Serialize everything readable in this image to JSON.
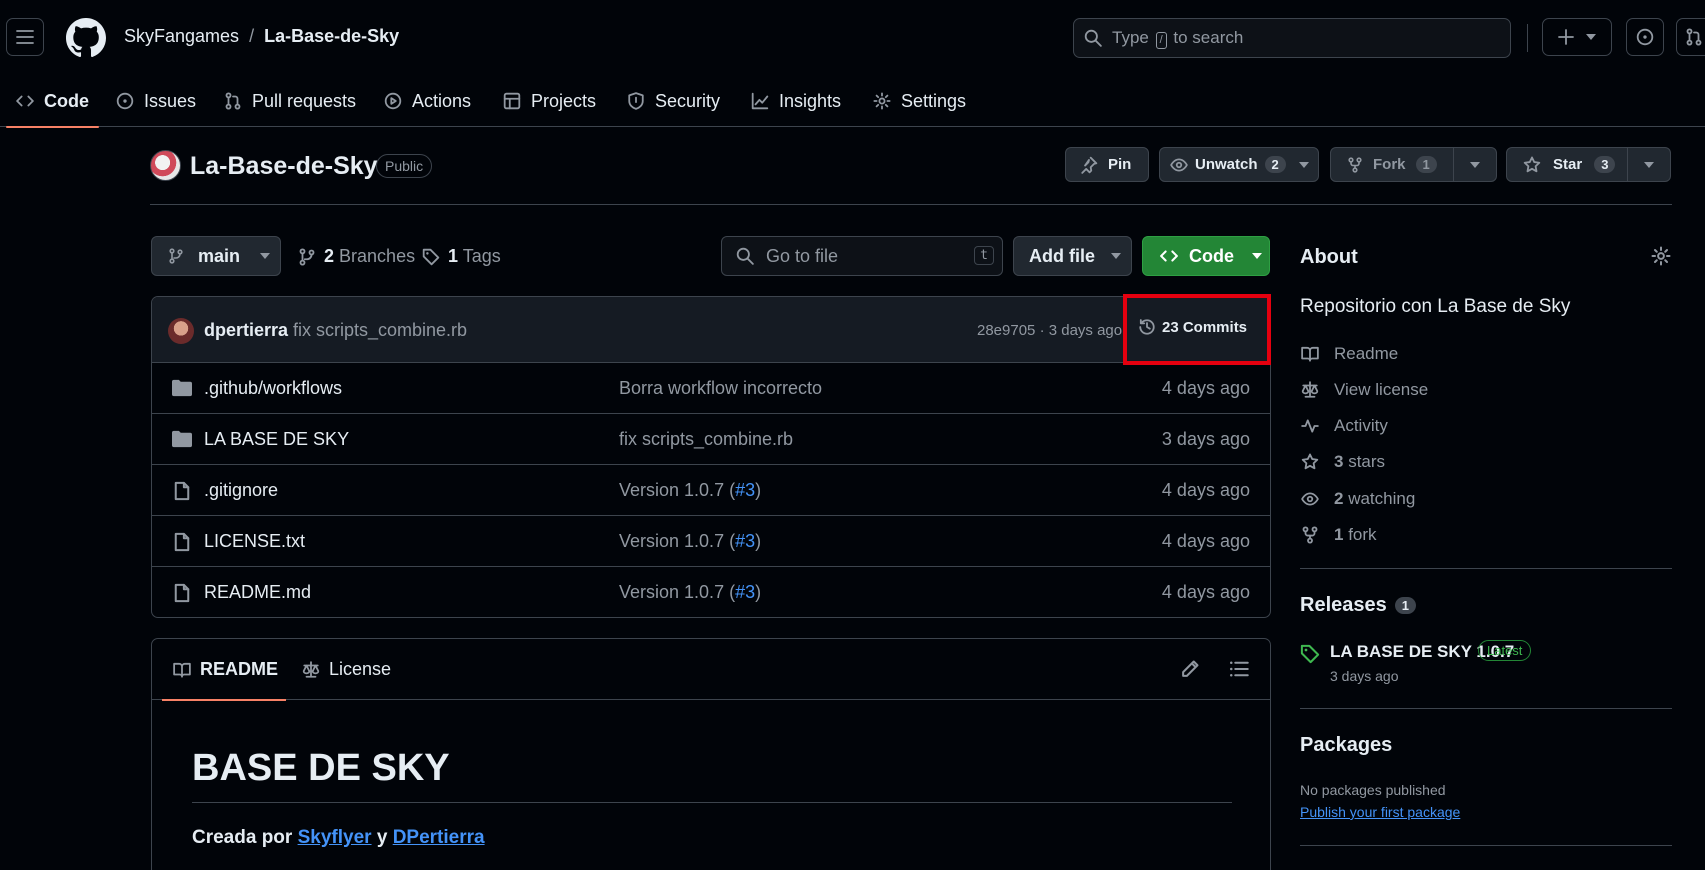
{
  "header": {
    "owner": "SkyFangames",
    "separator": "/",
    "repo": "La-Base-de-Sky",
    "search_before": "Type",
    "search_key": "/",
    "search_after": "to search"
  },
  "nav": {
    "tabs": [
      {
        "label": "Code",
        "icon": "code-icon",
        "active": true
      },
      {
        "label": "Issues",
        "icon": "issue-icon"
      },
      {
        "label": "Pull requests",
        "icon": "pull-request-icon"
      },
      {
        "label": "Actions",
        "icon": "play-icon"
      },
      {
        "label": "Projects",
        "icon": "table-icon"
      },
      {
        "label": "Security",
        "icon": "shield-icon"
      },
      {
        "label": "Insights",
        "icon": "graph-icon"
      },
      {
        "label": "Settings",
        "icon": "gear-icon"
      }
    ]
  },
  "repo_header": {
    "title": "La-Base-de-Sky",
    "visibility": "Public",
    "pin": "Pin",
    "unwatch": "Unwatch",
    "watch_count": "2",
    "fork": "Fork",
    "fork_count": "1",
    "star": "Star",
    "star_count": "3"
  },
  "toolbar": {
    "branch": "main",
    "branches_count": "2",
    "branches_label": "Branches",
    "tags_count": "1",
    "tags_label": "Tags",
    "goto_placeholder": "Go to file",
    "goto_key": "t",
    "add_file": "Add file",
    "code": "Code"
  },
  "commit": {
    "author": "dpertierra",
    "message": "fix scripts_combine.rb",
    "hash_time": "28e9705 · 3 days ago",
    "commits": "23 Commits",
    "highlight_color": "#e5000f"
  },
  "files": [
    {
      "name": ".github/workflows",
      "type": "folder",
      "message": "Borra workflow incorrecto",
      "link": "",
      "date": "4 days ago"
    },
    {
      "name": "LA BASE DE SKY",
      "type": "folder",
      "message": "fix scripts_combine.rb",
      "link": "",
      "date": "3 days ago"
    },
    {
      "name": ".gitignore",
      "type": "file",
      "message": "Version 1.0.7 (",
      "link": "#3",
      "date": "4 days ago"
    },
    {
      "name": "LICENSE.txt",
      "type": "file",
      "message": "Version 1.0.7 (",
      "link": "#3",
      "date": "4 days ago"
    },
    {
      "name": "README.md",
      "type": "file",
      "message": "Version 1.0.7 (",
      "link": "#3",
      "date": "4 days ago"
    }
  ],
  "readme": {
    "tab_readme": "README",
    "tab_license": "License",
    "heading": "BASE DE SKY",
    "byline_prefix": "Creada por",
    "author1": "Skyflyer",
    "conj": "y",
    "author2": "DPertierra"
  },
  "sidebar": {
    "about": "About",
    "description": "Repositorio con La Base de Sky",
    "readme": "Readme",
    "license": "View license",
    "activity": "Activity",
    "stars_count": "3",
    "stars_label": "stars",
    "watching_count": "2",
    "watching_label": "watching",
    "forks_count": "1",
    "forks_label": "fork",
    "releases": "Releases",
    "releases_count": "1",
    "release_name": "LA BASE DE SKY 1.0.7",
    "release_badge": "Latest",
    "release_date": "3 days ago",
    "packages": "Packages",
    "no_packages": "No packages published",
    "publish_link": "Publish your first package"
  },
  "colors": {
    "accent": "#f78166",
    "green": "#238636",
    "link": "#4493f8"
  }
}
